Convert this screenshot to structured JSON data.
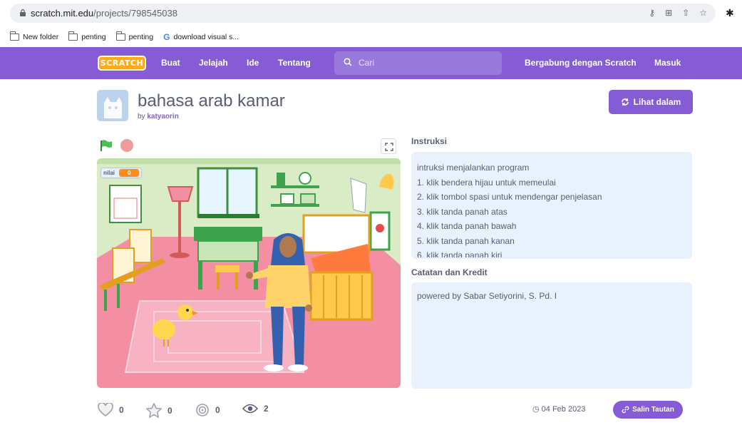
{
  "browser": {
    "url_host": "scratch.mit.edu",
    "url_path": "/projects/798545038",
    "bookmarks": [
      {
        "label": "New folder",
        "icon": "folder-icon"
      },
      {
        "label": "penting",
        "icon": "folder-icon"
      },
      {
        "label": "penting",
        "icon": "folder-icon"
      },
      {
        "label": "download visual s...",
        "icon": "google-icon"
      }
    ]
  },
  "menu": {
    "logo_text": "SCRATCH",
    "items": [
      "Buat",
      "Jelajah",
      "Ide",
      "Tentang"
    ],
    "search_placeholder": "Cari",
    "join": "Bergabung dengan Scratch",
    "signin": "Masuk"
  },
  "project": {
    "title": "bahasa arab kamar",
    "by_label": "by",
    "author": "katyaorin",
    "see_inside": "Lihat dalam"
  },
  "stage": {
    "variable_name": "nilai",
    "variable_value": "0"
  },
  "instructions": {
    "title": "Instruksi",
    "lines": [
      "intruksi menjalankan program",
      "1. klik bendera hijau untuk memeulai",
      "2. klik tombol spasi untuk mendengar penjelasan",
      "3. klik tanda panah atas",
      "4. klik tanda panah bawah",
      "5. klik tanda panah kanan",
      "6. klik tanda panah kiri"
    ]
  },
  "notes": {
    "title": "Catatan dan Kredit",
    "text": "powered by Sabar Setiyorini, S. Pd. I"
  },
  "stats": {
    "loves": "0",
    "favorites": "0",
    "remixes": "0",
    "views": "2",
    "date": "04 Feb 2023",
    "copy_link": "Salin Tautan"
  },
  "colors": {
    "scratch_purple": "#855cd6",
    "stage_floor": "#f48fa3",
    "stage_wall": "#d9ecc6",
    "panel_bg": "#e9f1fc"
  }
}
